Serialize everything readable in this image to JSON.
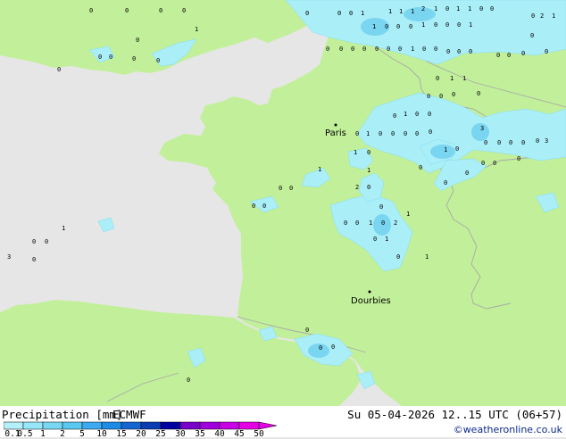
{
  "footer": {
    "title": "Precipitation [mm]",
    "model": "ECMWF",
    "valid": "Su 05-04-2026 12..15 UTC (06+57)",
    "credit": "©weatheronline.co.uk"
  },
  "legend": {
    "ticks": [
      "0.1",
      "0.5",
      "1",
      "2",
      "5",
      "10",
      "15",
      "20",
      "25",
      "30",
      "35",
      "40",
      "45",
      "50"
    ],
    "colors": [
      "#b4f0fa",
      "#96e6f8",
      "#78d8f4",
      "#5ac8f0",
      "#3caaf0",
      "#1e8ce6",
      "#1464d2",
      "#0a3cb4",
      "#0000a0",
      "#7800c8",
      "#a000dc",
      "#c800e6",
      "#e600e6"
    ]
  },
  "colors": {
    "land": "#c2f09a",
    "sea": "#e6e6e6",
    "border": "#a8a8a8",
    "rain_light": "#aaeef8",
    "rain_mid": "#7ad6f0"
  },
  "cities": [
    {
      "name": "Paris"
    },
    {
      "name": "Dourbies"
    }
  ],
  "precip_values": [
    "0",
    "1",
    "0",
    "0",
    "0",
    "0",
    "0",
    "0",
    "0",
    "0",
    "0",
    "1",
    "1",
    "1",
    "2",
    "1",
    "0",
    "1",
    "1",
    "0",
    "0",
    "0",
    "0",
    "0",
    "1",
    "1",
    "0",
    "0",
    "0",
    "1",
    "0",
    "0",
    "0",
    "1",
    "0",
    "2",
    "1",
    "0",
    "0",
    "0",
    "0",
    "0",
    "0",
    "0",
    "1",
    "0",
    "0",
    "0",
    "0",
    "0",
    "0",
    "0",
    "0",
    "0",
    "0",
    "0",
    "1",
    "1",
    "0",
    "0",
    "0",
    "0",
    "0",
    "1",
    "0",
    "0",
    "3",
    "0",
    "1",
    "0",
    "0",
    "0",
    "0",
    "0",
    "0",
    "0",
    "0",
    "0",
    "0",
    "3",
    "1",
    "0",
    "0",
    "1",
    "0",
    "0",
    "1",
    "1",
    "0",
    "0",
    "0",
    "0",
    "2",
    "0",
    "0",
    "0",
    "0",
    "0",
    "0",
    "0",
    "1",
    "0",
    "2",
    "1",
    "0",
    "1",
    "0",
    "1",
    "0",
    "0",
    "1",
    "3",
    "0",
    "0",
    "0",
    "0",
    "0",
    "0"
  ]
}
